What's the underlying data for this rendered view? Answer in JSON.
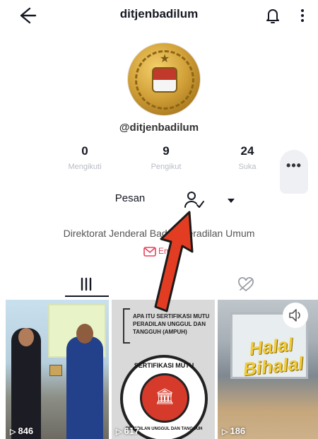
{
  "header": {
    "title": "ditjenbadilum",
    "back_icon": "arrow-left-icon",
    "bell_icon": "bell-icon",
    "more_icon": "more-vertical-icon"
  },
  "profile": {
    "handle": "@ditjenbadilum",
    "stats": [
      {
        "value": "0",
        "label": "Mengikuti"
      },
      {
        "value": "9",
        "label": "Pengikut"
      },
      {
        "value": "24",
        "label": "Suka"
      }
    ],
    "message_label": "Pesan",
    "bio": "Direktorat Jenderal Badan Peradilan Umum",
    "email_label": "Email"
  },
  "thumbnails": [
    {
      "views": "846"
    },
    {
      "views": "617",
      "caption": "APA ITU SERTIFIKASI MUTU PERADILAN UNGGUL DAN TANGGUH (AMPUH)",
      "seal_top": "SERTIFIKASI MUTU",
      "seal_bottom": "PERADILAN UNGGUL DAN TANGGUH"
    },
    {
      "views": "186",
      "banner": "Halal Bihalal"
    }
  ],
  "colors": {
    "accent": "#e8405a",
    "arrow": "#e23d22"
  }
}
